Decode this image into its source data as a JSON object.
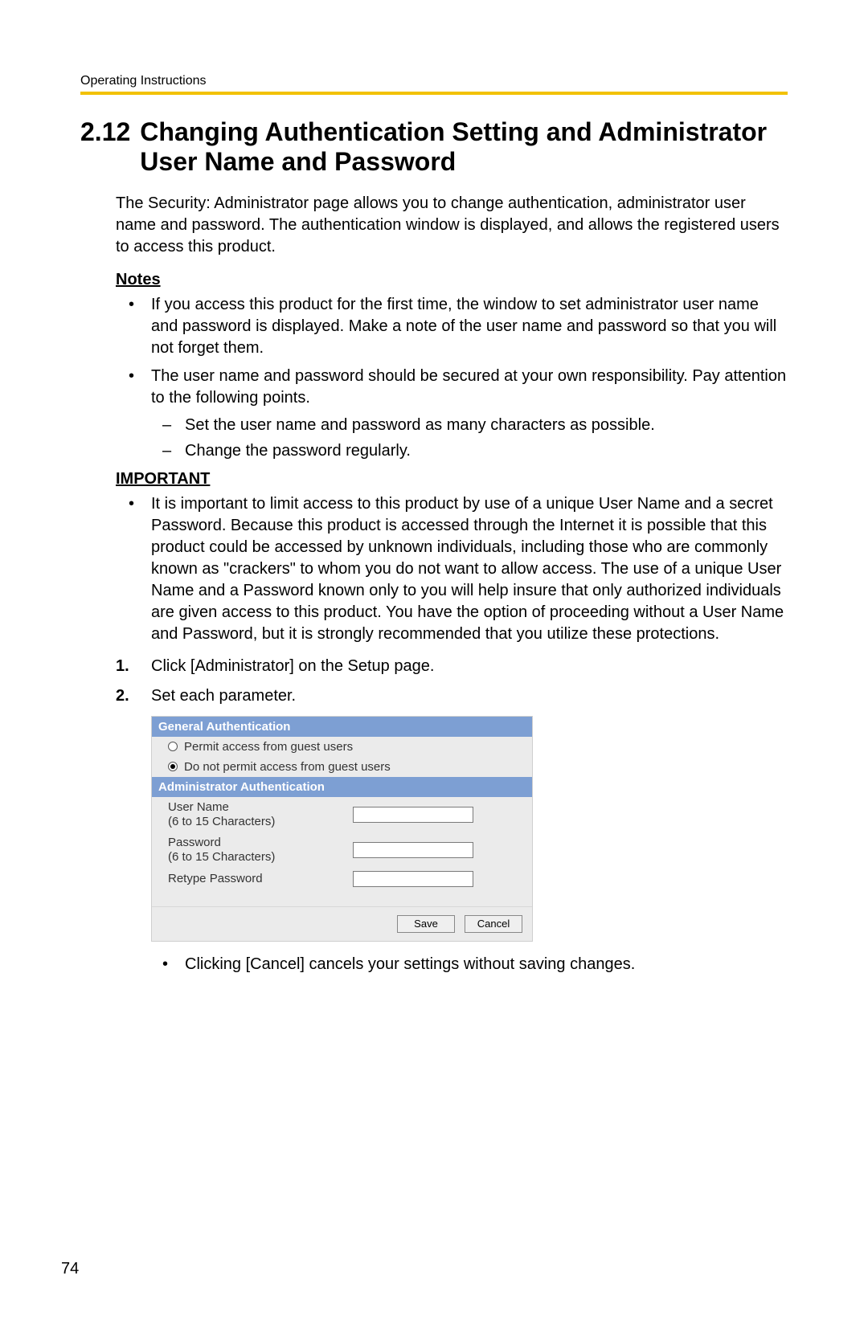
{
  "running_header": "Operating Instructions",
  "section_number": "2.12",
  "section_title": "Changing Authentication Setting and Administrator User Name and Password",
  "intro": "The Security: Administrator page allows you to change authentication, administrator user name and password. The authentication window is displayed, and allows the registered users to access this product.",
  "notes_heading": "Notes",
  "notes": {
    "item1": "If you access this product for the first time, the window to set administrator user name and password is displayed. Make a note of the user name and password so that you will not forget them.",
    "item2": "The user name and password should be secured at your own responsibility. Pay attention to the following points.",
    "sub1": "Set the user name and password as many characters as possible.",
    "sub2": "Change the password regularly."
  },
  "important_heading": "IMPORTANT",
  "important": {
    "item1": "It is important to limit access to this product by use of a unique User Name and a secret Password. Because this product is accessed through the Internet it is possible that this product could be accessed by unknown individuals, including those who are commonly known as \"crackers\" to whom you do not want to allow access. The use of a unique User Name and a Password known only to you will help insure that only authorized individuals are given access to this product. You have the option of proceeding without a User Name and Password, but it is strongly recommended that you utilize these protections."
  },
  "steps": {
    "s1_num": "1.",
    "s1": "Click [Administrator] on the Setup page.",
    "s2_num": "2.",
    "s2": "Set each parameter."
  },
  "screenshot": {
    "general_header": "General Authentication",
    "radio_permit": "Permit access from guest users",
    "radio_notpermit": "Do not permit access from guest users",
    "admin_header": "Administrator Authentication",
    "username_label": "User Name\n(6 to 15 Characters)",
    "password_label": "Password\n(6 to 15 Characters)",
    "retype_label": "Retype Password",
    "save_btn": "Save",
    "cancel_btn": "Cancel"
  },
  "cancel_note": "Clicking [Cancel] cancels your settings without saving changes.",
  "page_number": "74"
}
